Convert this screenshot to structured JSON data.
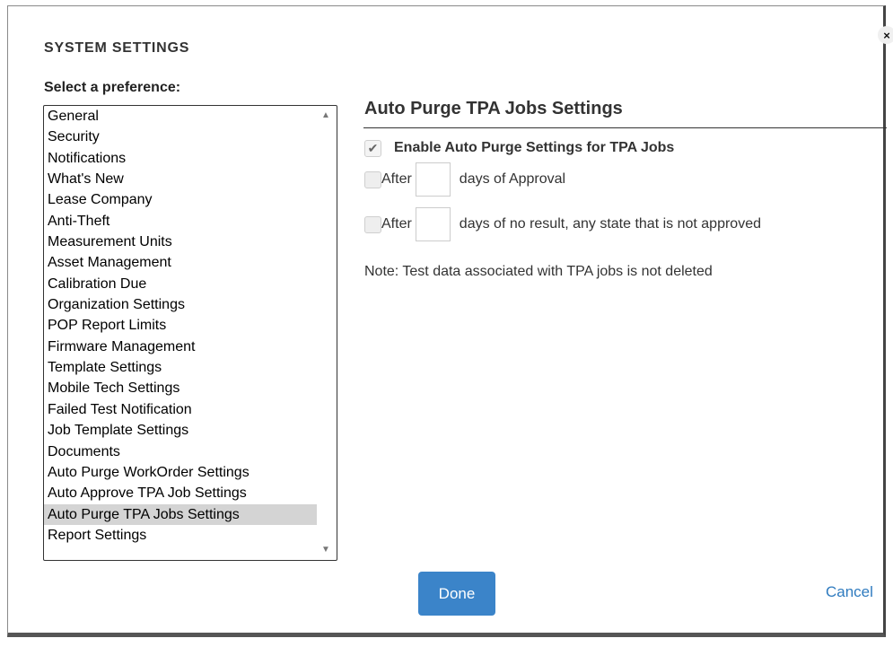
{
  "dialog": {
    "title": "SYSTEM SETTINGS",
    "close_icon": "×"
  },
  "preferences": {
    "label": "Select a preference:",
    "items": [
      "General",
      "Security",
      "Notifications",
      "What's New",
      "Lease Company",
      "Anti-Theft",
      "Measurement Units",
      "Asset Management",
      "Calibration Due",
      "Organization Settings",
      "POP Report Limits",
      "Firmware Management",
      "Template Settings",
      "Mobile Tech Settings",
      "Failed Test Notification",
      "Job Template Settings",
      "Documents",
      "Auto Purge WorkOrder Settings",
      "Auto Approve TPA Job Settings",
      "Auto Purge TPA Jobs Settings",
      "Report Settings"
    ],
    "selected": "Auto Purge TPA Jobs Settings",
    "scroll_up_icon": "▲",
    "scroll_down_icon": "▼"
  },
  "section": {
    "title": "Auto Purge TPA Jobs Settings",
    "enable": {
      "checked": true,
      "check_glyph": "✔",
      "label": "Enable Auto Purge Settings for TPA Jobs"
    },
    "approval_row": {
      "checked": false,
      "after_label": "After",
      "value": "",
      "suffix": "days of Approval"
    },
    "no_result_row": {
      "checked": false,
      "after_label": "After",
      "value": "",
      "suffix": "days of no result, any state that is not approved"
    },
    "note": "Note: Test data associated with TPA jobs is not deleted"
  },
  "footer": {
    "done_label": "Done",
    "cancel_label": "Cancel"
  },
  "colors": {
    "primary_button": "#3b84c9",
    "link": "#2f7bbf",
    "selected_row": "#d4d4d4"
  }
}
